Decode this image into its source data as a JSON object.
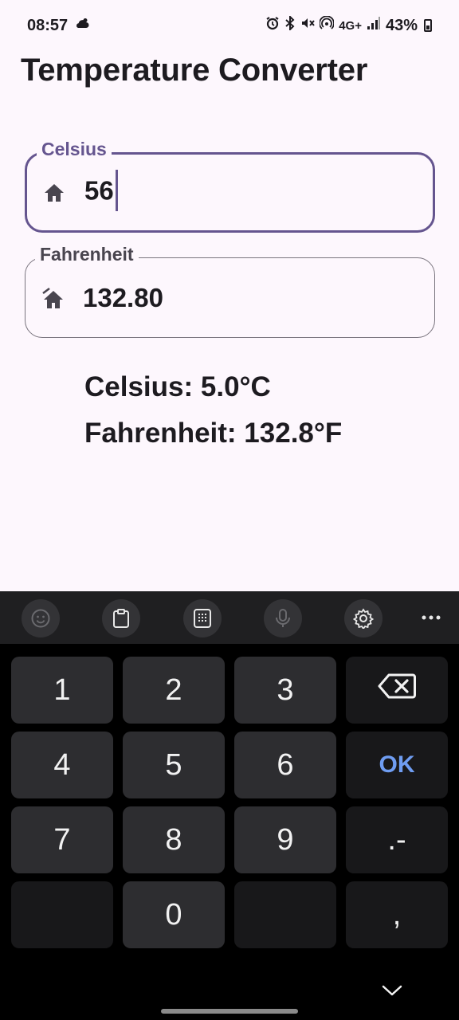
{
  "status_bar": {
    "time": "08:57",
    "network": "4G+",
    "battery": "43%"
  },
  "app": {
    "title": "Temperature Converter"
  },
  "celsius_field": {
    "label": "Celsius",
    "value": "56",
    "icon": "home-icon"
  },
  "fahrenheit_field": {
    "label": "Fahrenheit",
    "value": "132.80",
    "icon": "home-outlined-icon"
  },
  "results": {
    "celsius_text": "Celsius: 5.0°C",
    "fahrenheit_text": "Fahrenheit: 132.8°F"
  },
  "keyboard": {
    "toolbar_icons": [
      "emoji-icon",
      "clipboard-icon",
      "keypad-icon",
      "microphone-icon",
      "settings-icon",
      "more-icon"
    ],
    "keys": {
      "k1": "1",
      "k2": "2",
      "k3": "3",
      "k4": "4",
      "k5": "5",
      "k6": "6",
      "k7": "7",
      "k8": "8",
      "k9": "9",
      "k0": "0",
      "ok": "OK",
      "dot_minus": ".-",
      "comma": ","
    }
  },
  "colors": {
    "background": "#fdf7fd",
    "accent": "#65558f",
    "keyboard_bg": "#000000",
    "key_bg": "#2d2d30",
    "ok_text": "#6f9df2"
  }
}
